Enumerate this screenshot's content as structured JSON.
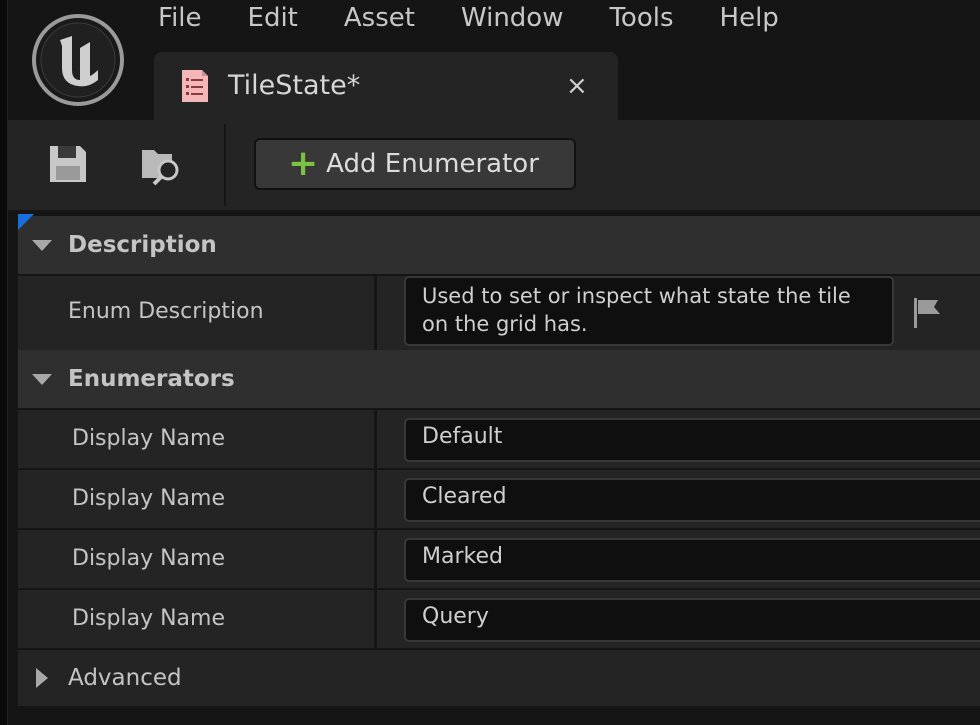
{
  "menu": [
    "File",
    "Edit",
    "Asset",
    "Window",
    "Tools",
    "Help"
  ],
  "tab": {
    "title": "TileState*",
    "close": "×"
  },
  "toolbar": {
    "add_enumerator_label": "Add Enumerator",
    "add_icon": "+"
  },
  "sections": {
    "description": {
      "title": "Description",
      "enum_description_label": "Enum Description",
      "enum_description_value": "Used to set or inspect what state the tile on the grid has."
    },
    "enumerators": {
      "title": "Enumerators",
      "rows": [
        {
          "label": "Display Name",
          "value": "Default"
        },
        {
          "label": "Display Name",
          "value": "Cleared"
        },
        {
          "label": "Display Name",
          "value": "Marked"
        },
        {
          "label": "Display Name",
          "value": "Query"
        }
      ]
    },
    "advanced": {
      "title": "Advanced"
    }
  },
  "icons": {
    "logo": "unreal-logo-icon",
    "tab": "enum-asset-icon",
    "save": "save-icon",
    "browse": "browse-asset-icon",
    "flag": "flag-icon"
  },
  "colors": {
    "accent_plus": "#7cc242",
    "corner_marker": "#1a6fe0",
    "tab_icon": "#f3b7b7"
  }
}
